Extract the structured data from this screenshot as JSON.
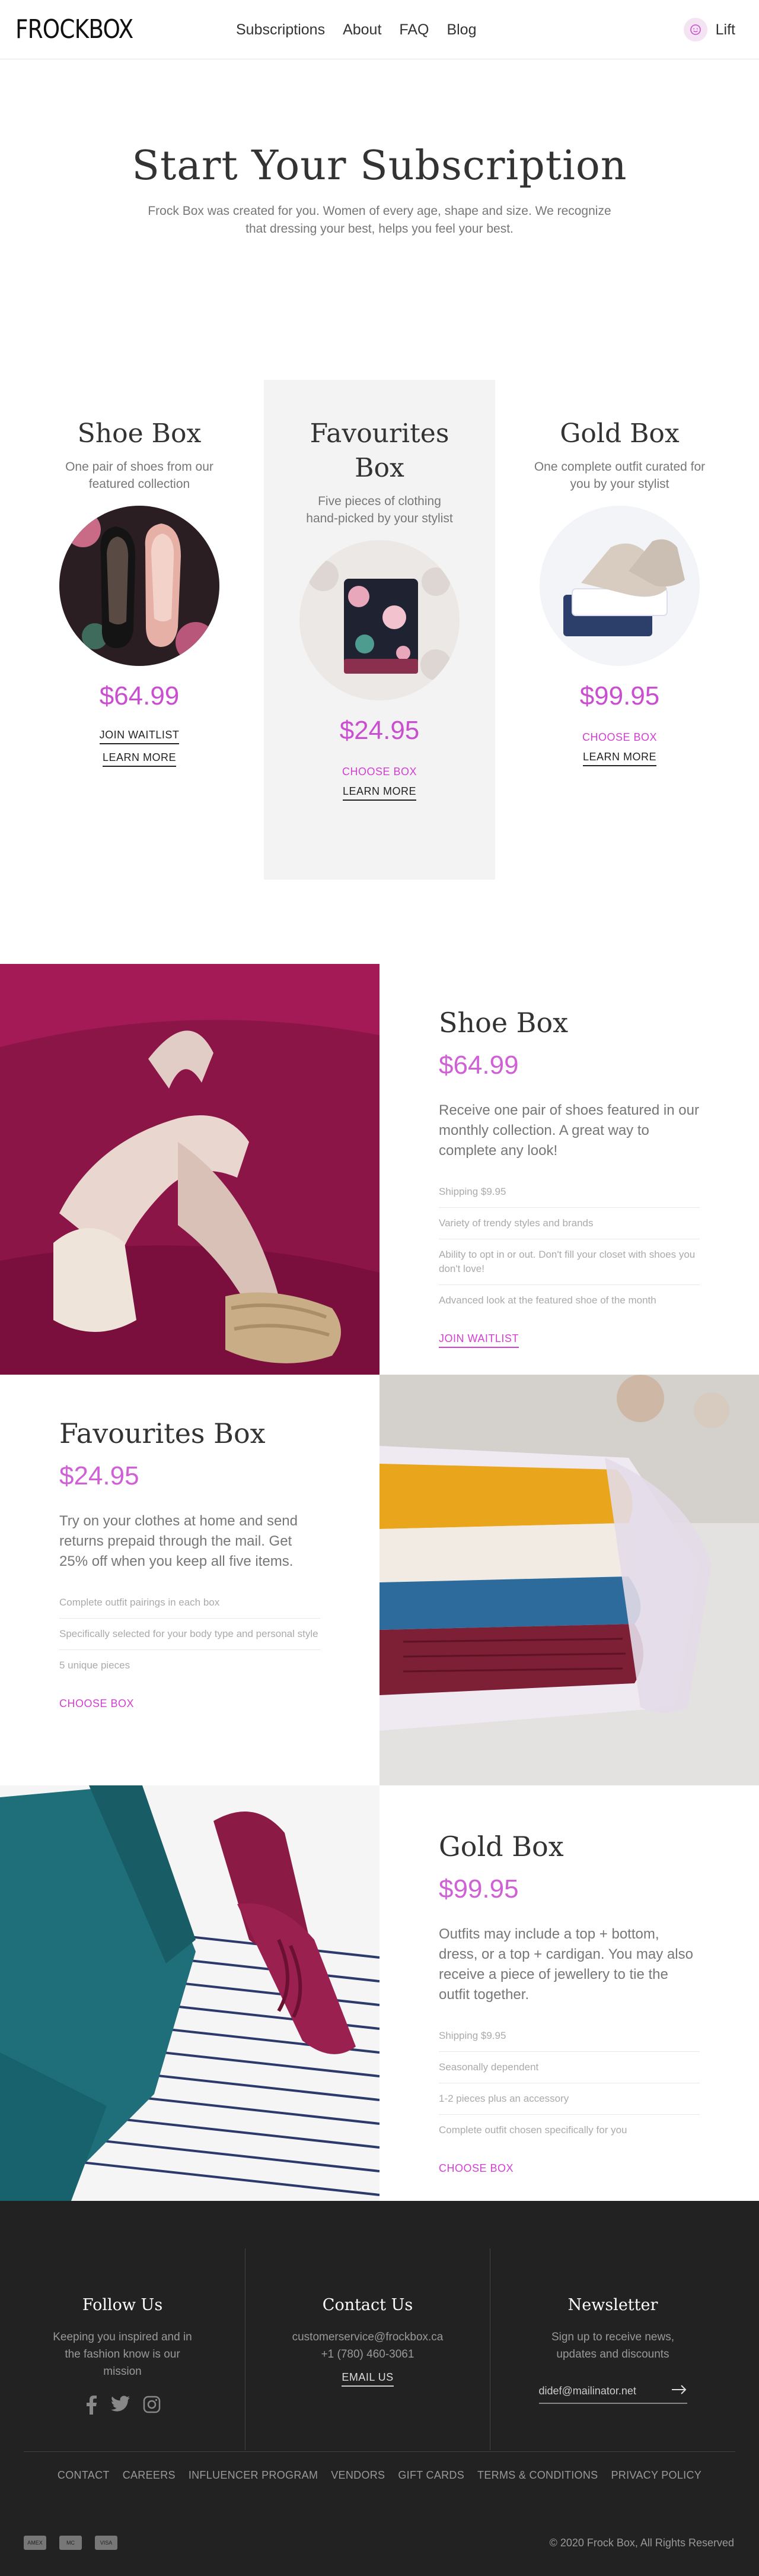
{
  "header": {
    "logo": "FROCKBOX",
    "nav": [
      "Subscriptions",
      "About",
      "FAQ",
      "Blog"
    ],
    "account_label": "Lift"
  },
  "hero": {
    "title": "Start Your Subscription",
    "subtitle": "Frock Box was created for you. Women of every age, shape and size. We recognize that dressing your best, helps you feel your best."
  },
  "boxes": [
    {
      "title": "Shoe Box",
      "desc": "One pair of shoes from our featured collection",
      "price": "$64.99",
      "primary": "JOIN WAITLIST",
      "secondary": "LEARN MORE"
    },
    {
      "title": "Favourites Box",
      "desc": "Five pieces of clothing hand-picked by your stylist",
      "price": "$24.95",
      "primary": "CHOOSE BOX",
      "secondary": "LEARN MORE"
    },
    {
      "title": "Gold Box",
      "desc": "One complete outfit curated for you by your stylist",
      "price": "$99.95",
      "primary": "CHOOSE BOX",
      "secondary": "LEARN MORE"
    }
  ],
  "details": [
    {
      "title": "Shoe Box",
      "price": "$64.99",
      "lead": "Receive one pair of shoes featured in our monthly collection. A great way to complete any look!",
      "features": [
        "Shipping $9.95",
        "Variety of trendy styles and brands",
        "Ability to opt in or out. Don't fill your closet with shoes you don't love!",
        "Advanced look at the featured shoe of the month"
      ],
      "cta": "JOIN WAITLIST"
    },
    {
      "title": "Favourites Box",
      "price": "$24.95",
      "lead": "Try on your clothes at home and send returns prepaid through the mail. Get 25% off when you keep all five items.",
      "features": [
        "Complete outfit pairings in each box",
        "Specifically selected for your body type and personal style",
        "5 unique pieces"
      ],
      "cta": "CHOOSE BOX"
    },
    {
      "title": "Gold Box",
      "price": "$99.95",
      "lead": "Outfits may include a top + bottom, dress, or a top + cardigan. You may also receive a piece of jewellery to tie the outfit together.",
      "features": [
        "Shipping $9.95",
        "Seasonally dependent",
        "1-2 pieces plus an accessory",
        "Complete outfit chosen specifically for you"
      ],
      "cta": "CHOOSE BOX"
    }
  ],
  "footer": {
    "follow": {
      "title": "Follow Us",
      "text": "Keeping you inspired and in the fashion know is our mission"
    },
    "contact": {
      "title": "Contact Us",
      "email": "customerservice@frockbox.ca",
      "phone": "+1 (780) 460-3061",
      "button": "EMAIL US"
    },
    "newsletter": {
      "title": "Newsletter",
      "text": "Sign up to receive news, updates and discounts",
      "input_value": "didef@mailinator.net"
    },
    "links": [
      "CONTACT",
      "CAREERS",
      "INFLUENCER PROGRAM",
      "VENDORS",
      "GIFT CARDS",
      "TERMS & CONDITIONS",
      "PRIVACY POLICY"
    ],
    "payments": [
      "AMEX",
      "MC",
      "VISA"
    ],
    "copyright": "© 2020 Frock Box, All Rights Reserved"
  },
  "colors": {
    "accent": "#d43fd3",
    "price": "#c94ed0",
    "footer_bg": "#222222"
  }
}
